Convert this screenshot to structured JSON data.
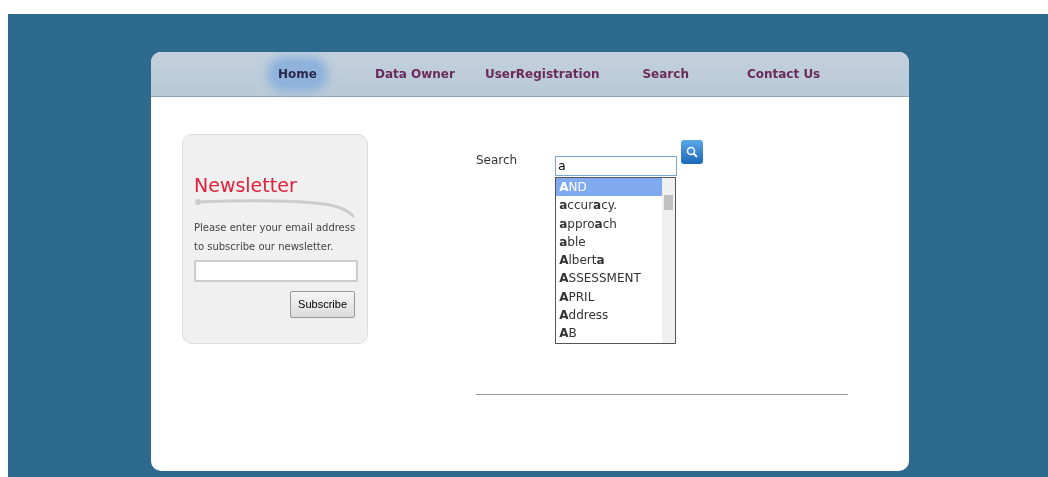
{
  "nav": [
    {
      "label": "Home",
      "selected": true
    },
    {
      "label": "Data Owner",
      "selected": false
    },
    {
      "label": "UserRegistration",
      "selected": false
    },
    {
      "label": "Search",
      "selected": false
    },
    {
      "label": "Contact Us",
      "selected": false
    }
  ],
  "newsletter": {
    "title": "Newsletter",
    "text": "Please enter your email address to subscribe our newsletter.",
    "button": "Subscribe"
  },
  "search": {
    "label": "Search",
    "value": "a",
    "suggestions": [
      {
        "text": "**A**ND",
        "selected": true
      },
      {
        "text": "**a**ccur**a**cy.",
        "selected": false
      },
      {
        "text": "**a**ppro**a**ch",
        "selected": false
      },
      {
        "text": "**a**ble",
        "selected": false
      },
      {
        "text": "**A**lbert**a**",
        "selected": false
      },
      {
        "text": "**A**SSESSMENT",
        "selected": false
      },
      {
        "text": "**A**PRIL",
        "selected": false
      },
      {
        "text": "**A**ddress",
        "selected": false
      },
      {
        "text": "**A**B",
        "selected": false
      }
    ]
  }
}
